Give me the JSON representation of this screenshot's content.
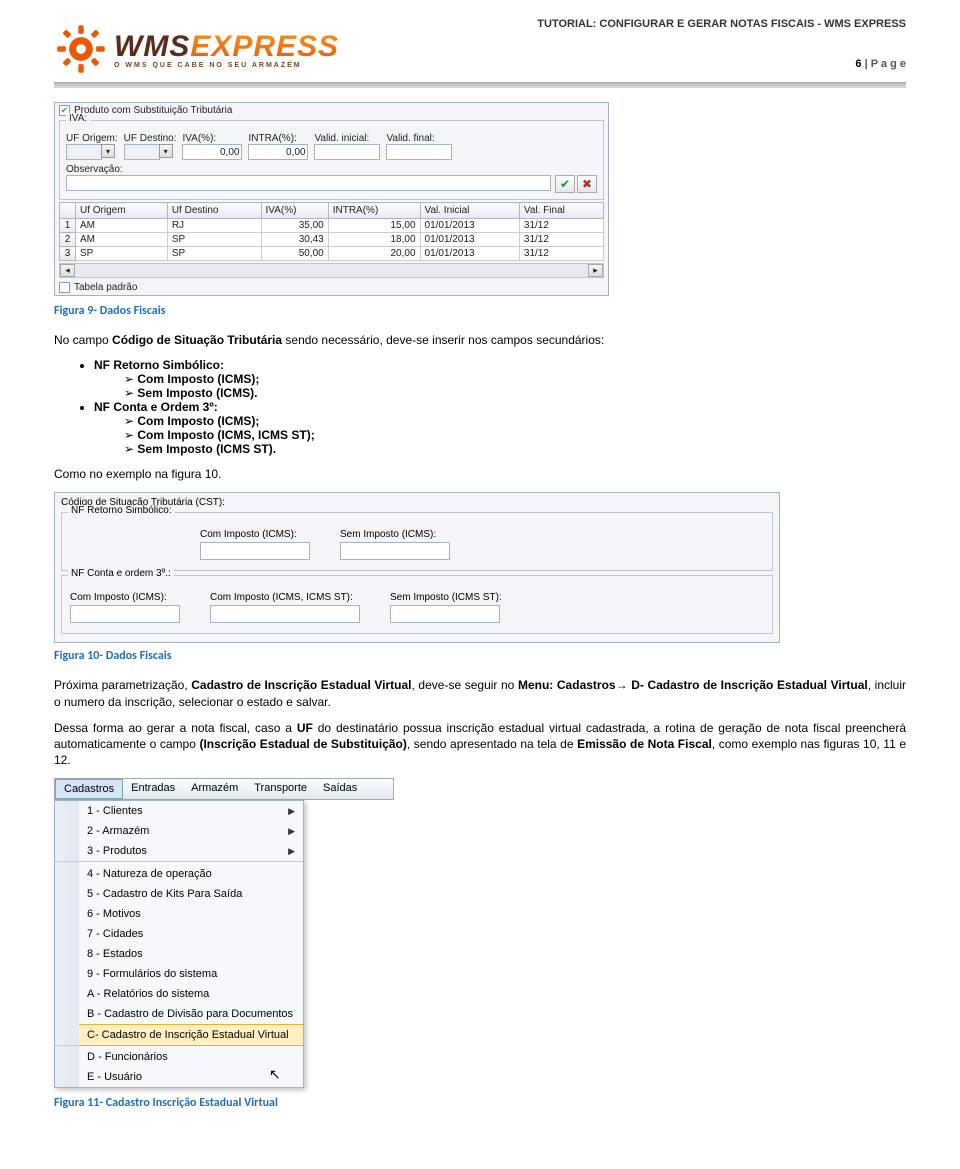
{
  "doc_header": "TUTORIAL: CONFIGURAR E GERAR NOTAS FISCAIS - WMS EXPRESS",
  "page_label_num": "6",
  "page_label_text": " | P a g e",
  "logo": {
    "wms": "WMS",
    "express": "EXPRESS",
    "tagline": "O WMS QUE CABE NO SEU ARMAZÉM"
  },
  "form1": {
    "chk_sub_trib": "Produto com Substituição Tributária",
    "iva_legend": "IVA:",
    "cols": {
      "uf_origem": "UF Origem:",
      "uf_destino": "UF Destino:",
      "iva": "IVA(%):",
      "intra": "INTRA(%):",
      "valid_ini": "Valid. inicial:",
      "valid_fin": "Valid. final:"
    },
    "iva_val": "0,00",
    "intra_val": "0,00",
    "obs_label": "Observação:",
    "check_icon": "✔",
    "x_icon": "✖",
    "grid_headers": {
      "uf_origem": "Uf Origem",
      "uf_destino": "Uf Destino",
      "iva": "IVA(%)",
      "intra": "INTRA(%)",
      "val_ini": "Val. Inicial",
      "val_fin": "Val. Final"
    },
    "rows": [
      {
        "n": "1",
        "o": "AM",
        "d": "RJ",
        "iva": "35,00",
        "intra": "15,00",
        "vi": "01/01/2013",
        "vf": "31/12"
      },
      {
        "n": "2",
        "o": "AM",
        "d": "SP",
        "iva": "30,43",
        "intra": "18,00",
        "vi": "01/01/2013",
        "vf": "31/12"
      },
      {
        "n": "3",
        "o": "SP",
        "d": "SP",
        "iva": "50,00",
        "intra": "20,00",
        "vi": "01/01/2013",
        "vf": "31/12"
      }
    ],
    "chk_tab_padrao": "Tabela padrão"
  },
  "caption1": "Figura 9- Dados Fiscais",
  "para1_a": "No campo ",
  "para1_b": "Código de Situação Tributária",
  "para1_c": " sendo necessário, deve-se inserir nos campos secundários:",
  "list1": {
    "i1": "NF Retorno Simbólico:",
    "i1a": "Com Imposto (ICMS);",
    "i1b": "Sem Imposto (ICMS).",
    "i2": "NF Conta e Ordem 3º:",
    "i2a": "Com Imposto (ICMS);",
    "i2b": "Com Imposto (ICMS, ICMS ST);",
    "i2c": "Sem Imposto (ICMS ST)."
  },
  "para2": "Como no exemplo na figura 10.",
  "form2": {
    "cst_label": "Código de Situação Tributária (CST):",
    "fs1_legend": "NF Retorno Simbólico:",
    "com_icms": "Com Imposto (ICMS):",
    "sem_icms": "Sem Imposto (ICMS):",
    "fs2_legend": "NF Conta e ordem 3º.:",
    "com_icms_st": "Com Imposto (ICMS, ICMS ST):",
    "sem_icms_st": "Sem Imposto (ICMS ST):"
  },
  "caption2": "Figura 10- Dados Fiscais",
  "para3_a": "Próxima parametrização, ",
  "para3_b": "Cadastro de Inscrição Estadual Virtual",
  "para3_c": ", deve-se seguir no ",
  "para3_d": "Menu: Cadastros",
  "para3_e": "→ ",
  "para3_f": "D- Cadastro de Inscrição Estadual Virtual",
  "para3_g": ", incluir o numero da inscrição, selecionar o estado e salvar.",
  "para4_a": "Dessa forma ao gerar a nota fiscal, caso a ",
  "para4_b": "UF",
  "para4_c": " do destinatário possua inscrição estadual virtual cadastrada, a rotina de geração de nota fiscal preencherá automaticamente o campo ",
  "para4_d": "(Inscrição Estadual de Substituição)",
  "para4_e": ", sendo apresentado na tela de ",
  "para4_f": "Emissão de Nota Fiscal",
  "para4_g": ", como exemplo nas figuras 10, 11 e 12.",
  "menu": {
    "items": [
      "Cadastros",
      "Entradas",
      "Armazém",
      "Transporte",
      "Saídas"
    ],
    "drop": [
      {
        "t": "1 - Clientes",
        "arr": true
      },
      {
        "t": "2 - Armazém",
        "arr": true
      },
      {
        "t": "3 - Produtos",
        "arr": true
      },
      {
        "sep": true
      },
      {
        "t": "4 - Natureza de operação"
      },
      {
        "t": "5 - Cadastro de Kits Para Saída"
      },
      {
        "t": "6 - Motivos"
      },
      {
        "t": "7 - Cidades"
      },
      {
        "t": "8 - Estados"
      },
      {
        "t": "9 - Formulários do sistema"
      },
      {
        "t": "A - Relatórios do sistema"
      },
      {
        "t": "B - Cadastro de Divisão para Documentos"
      },
      {
        "t": "C- Cadastro de Inscrição Estadual Virtual",
        "hover": true
      },
      {
        "sep": true
      },
      {
        "t": "D - Funcionários"
      },
      {
        "t": "E - Usuário"
      }
    ]
  },
  "caption3": "Figura 11- Cadastro Inscrição Estadual Virtual"
}
